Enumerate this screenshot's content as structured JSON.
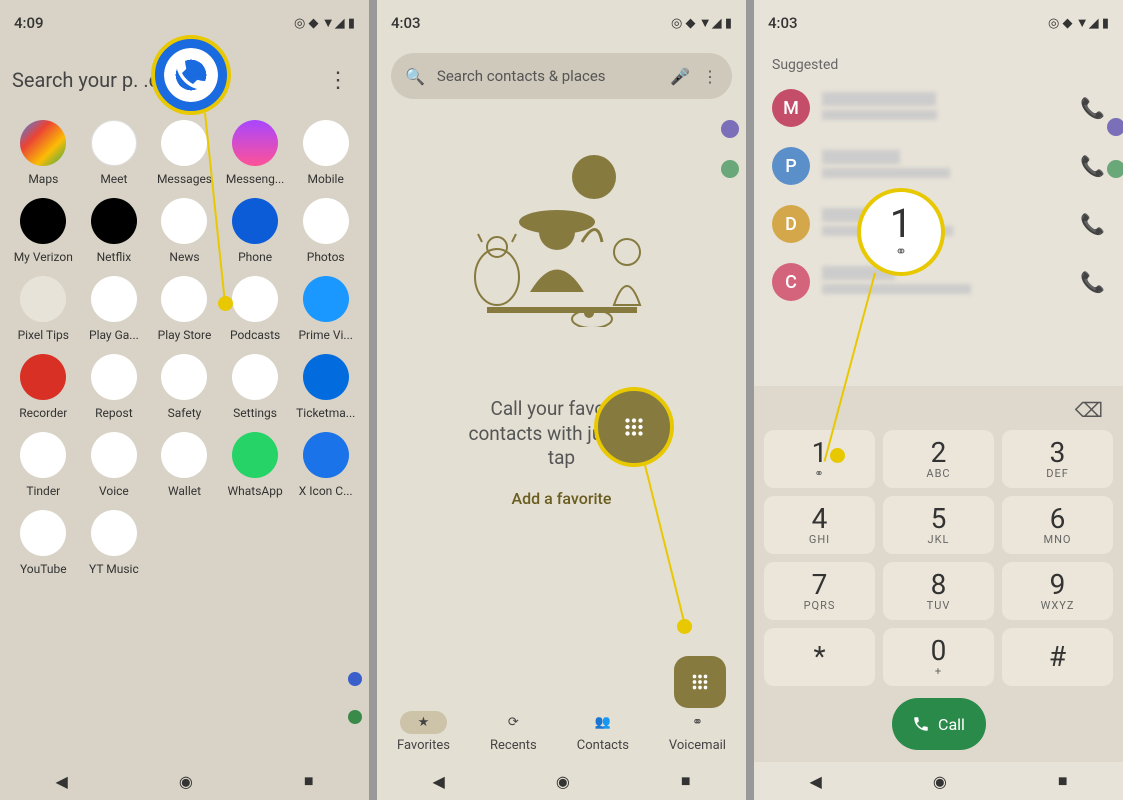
{
  "screen1": {
    "time": "4:09",
    "search_placeholder": "Search your p.      .d mo...",
    "apps": [
      {
        "label": "Maps",
        "cls": "ic-maps"
      },
      {
        "label": "Meet",
        "cls": "ic-meet"
      },
      {
        "label": "Messages",
        "cls": "ic-messages"
      },
      {
        "label": "Messeng...",
        "cls": "ic-messenger"
      },
      {
        "label": "Mobile",
        "cls": "ic-mobile"
      },
      {
        "label": "My Verizon",
        "cls": "ic-verizon"
      },
      {
        "label": "Netflix",
        "cls": "ic-netflix"
      },
      {
        "label": "News",
        "cls": "ic-news"
      },
      {
        "label": "Phone",
        "cls": "ic-phone"
      },
      {
        "label": "Photos",
        "cls": "ic-photos"
      },
      {
        "label": "Pixel Tips",
        "cls": "ic-pixeltips"
      },
      {
        "label": "Play Ga...",
        "cls": "ic-playgames"
      },
      {
        "label": "Play Store",
        "cls": "ic-playstore"
      },
      {
        "label": "Podcasts",
        "cls": "ic-podcasts"
      },
      {
        "label": "Prime Vi...",
        "cls": "ic-primevideo"
      },
      {
        "label": "Recorder",
        "cls": "ic-recorder"
      },
      {
        "label": "Repost",
        "cls": "ic-repost"
      },
      {
        "label": "Safety",
        "cls": "ic-safety"
      },
      {
        "label": "Settings",
        "cls": "ic-settings"
      },
      {
        "label": "Ticketma...",
        "cls": "ic-ticketmaster"
      },
      {
        "label": "Tinder",
        "cls": "ic-tinder"
      },
      {
        "label": "Voice",
        "cls": "ic-voice"
      },
      {
        "label": "Wallet",
        "cls": "ic-wallet"
      },
      {
        "label": "WhatsApp",
        "cls": "ic-whatsapp"
      },
      {
        "label": "X Icon C...",
        "cls": "ic-xicon"
      },
      {
        "label": "YouTube",
        "cls": "ic-youtube"
      },
      {
        "label": "YT Music",
        "cls": "ic-ytmusic"
      }
    ]
  },
  "screen2": {
    "time": "4:03",
    "search_placeholder": "Search contacts & places",
    "fav_line1": "Call your favorite",
    "fav_line2": "contacts with just one",
    "fav_line3": "tap",
    "add_favorite": "Add a favorite",
    "nav": [
      {
        "label": "Favorites",
        "active": true
      },
      {
        "label": "Recents",
        "active": false
      },
      {
        "label": "Contacts",
        "active": false
      },
      {
        "label": "Voicemail",
        "active": false
      }
    ]
  },
  "screen3": {
    "time": "4:03",
    "suggested": "Suggested",
    "contacts": [
      {
        "letter": "M",
        "color": "#c44d6a"
      },
      {
        "letter": "P",
        "color": "#5a8fc9"
      },
      {
        "letter": "D",
        "color": "#d4a84a"
      },
      {
        "letter": "C",
        "color": "#d4647c"
      }
    ],
    "keys": [
      {
        "num": "1",
        "let": "⚭"
      },
      {
        "num": "2",
        "let": "ABC"
      },
      {
        "num": "3",
        "let": "DEF"
      },
      {
        "num": "4",
        "let": "GHI"
      },
      {
        "num": "5",
        "let": "JKL"
      },
      {
        "num": "6",
        "let": "MNO"
      },
      {
        "num": "7",
        "let": "PQRS"
      },
      {
        "num": "8",
        "let": "TUV"
      },
      {
        "num": "9",
        "let": "WXYZ"
      },
      {
        "num": "*",
        "let": ""
      },
      {
        "num": "0",
        "let": "+"
      },
      {
        "num": "#",
        "let": ""
      }
    ],
    "call_label": "Call"
  }
}
